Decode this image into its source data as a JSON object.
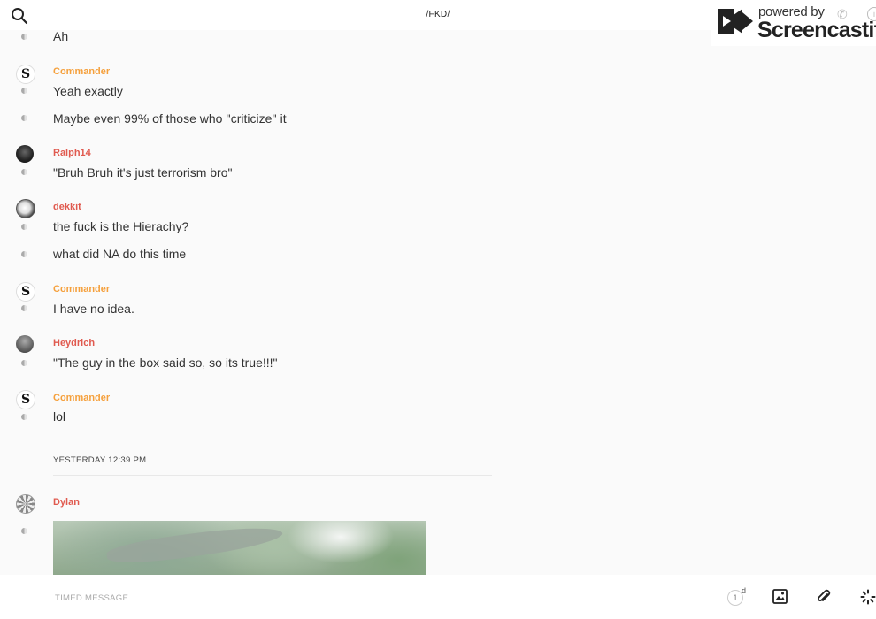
{
  "header": {
    "title": "/FKD/"
  },
  "watermark": {
    "powered_by": "powered by",
    "brand": "Screencastify"
  },
  "messages": [
    {
      "text": "Ah"
    },
    {
      "sender": "Commander",
      "text": "Yeah exactly"
    },
    {
      "text": "Maybe even 99% of those who ''criticize'' it"
    },
    {
      "sender": "Ralph14",
      "text": "\"Bruh Bruh it's just terrorism bro\""
    },
    {
      "sender": "dekkit",
      "text": "the fuck is the Hierachy?"
    },
    {
      "text": "what did NA do this time"
    },
    {
      "sender": "Commander",
      "text": "I have no idea."
    },
    {
      "sender": "Heydrich",
      "text": "\"The guy in the box said so, so its true!!!\""
    },
    {
      "sender": "Commander",
      "text": "lol"
    },
    {
      "sender": "Dylan"
    }
  ],
  "day_separator": "YESTERDAY 12:39 PM",
  "composer": {
    "placeholder": "TIMED MESSAGE",
    "timer_value": "1",
    "timer_unit": "d"
  },
  "colors": {
    "sender_orange": "#f5a03c",
    "sender_red": "#e05a4f"
  },
  "icons": {
    "search": "search-icon",
    "phone": "phone-icon",
    "info": "info-icon",
    "image": "image-icon",
    "attach": "paperclip-icon",
    "loading": "spinner-icon"
  }
}
